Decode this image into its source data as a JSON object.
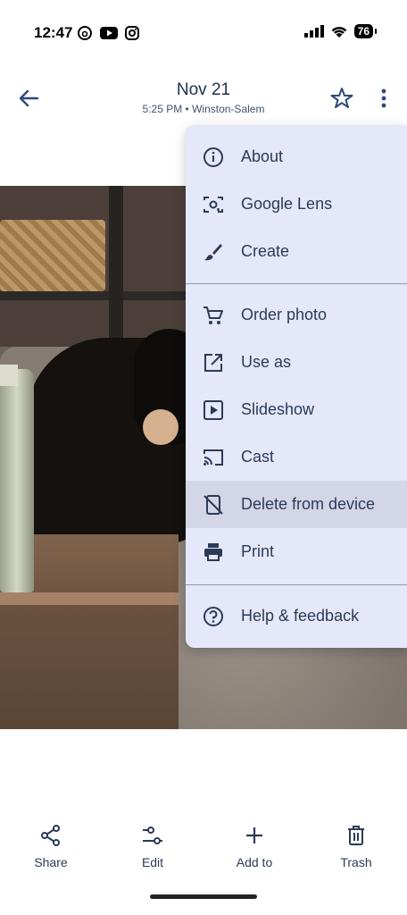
{
  "status_bar": {
    "time": "12:47",
    "battery": "76",
    "app_icons": [
      "threads-icon",
      "youtube-icon",
      "instagram-icon"
    ],
    "system_icons": [
      "cellular-signal-icon",
      "wifi-icon",
      "battery-icon"
    ]
  },
  "header": {
    "title": "Nov 21",
    "subtitle": "5:25 PM • Winston-Salem"
  },
  "menu": {
    "group1": [
      {
        "label": "About",
        "icon": "info-icon"
      },
      {
        "label": "Google Lens",
        "icon": "lens-icon"
      },
      {
        "label": "Create",
        "icon": "brush-icon"
      }
    ],
    "group2": [
      {
        "label": "Order photo",
        "icon": "cart-icon"
      },
      {
        "label": "Use as",
        "icon": "open-external-icon"
      },
      {
        "label": "Slideshow",
        "icon": "slideshow-icon"
      },
      {
        "label": "Cast",
        "icon": "cast-icon"
      },
      {
        "label": "Delete from device",
        "icon": "delete-device-icon",
        "highlighted": true
      },
      {
        "label": "Print",
        "icon": "print-icon"
      }
    ],
    "group3": [
      {
        "label": "Help & feedback",
        "icon": "help-icon"
      }
    ]
  },
  "bottom_actions": [
    {
      "label": "Share",
      "icon": "share-icon"
    },
    {
      "label": "Edit",
      "icon": "edit-sliders-icon"
    },
    {
      "label": "Add to",
      "icon": "plus-icon"
    },
    {
      "label": "Trash",
      "icon": "trash-icon"
    }
  ],
  "colors": {
    "menu_background": "#e4e8fa",
    "menu_highlight": "#d2d6e7",
    "text_primary": "#1f2f4d"
  }
}
